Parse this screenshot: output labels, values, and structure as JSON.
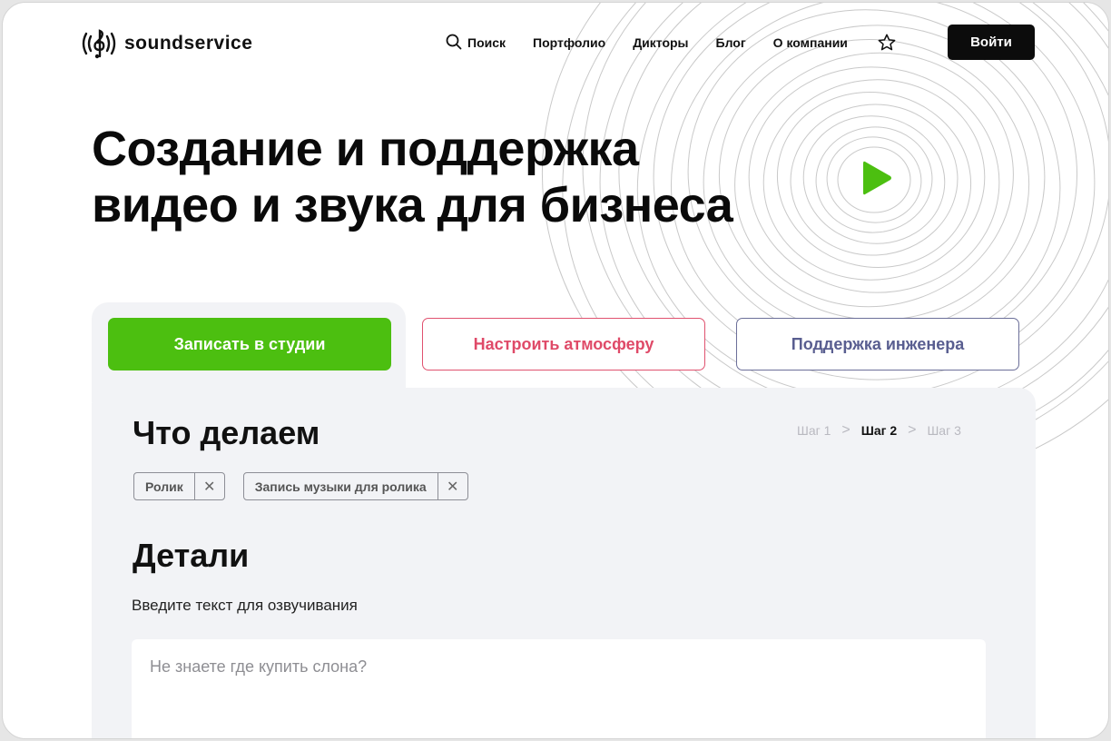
{
  "brand": {
    "logo_text": "soundservice"
  },
  "nav": {
    "search": "Поиск",
    "portfolio": "Портфолио",
    "speakers": "Дикторы",
    "blog": "Блог",
    "about": "О компании",
    "login": "Войти"
  },
  "hero": {
    "title_line1": "Создание и поддержка",
    "title_line2": "видео и звука для бизнеса"
  },
  "tabs": [
    {
      "label": "Записать в студии"
    },
    {
      "label": "Настроить атмосферу"
    },
    {
      "label": "Поддержка инженера"
    }
  ],
  "form": {
    "section1_title": "Что делаем",
    "steps": [
      "Шаг 1",
      "Шаг 2",
      "Шаг 3"
    ],
    "chips": [
      {
        "label": "Ролик"
      },
      {
        "label": "Запись музыки для ролика"
      }
    ],
    "section2_title": "Детали",
    "text_label": "Введите текст для озвучивания",
    "text_placeholder": "Не знаете где купить слона?"
  },
  "colors": {
    "primary_green": "#4cbf10",
    "accent_pink": "#e0526f",
    "accent_indigo": "#6c6f99",
    "dark": "#0c0c0c",
    "panel_bg": "#f2f3f6"
  },
  "icons": {
    "search": "search-icon",
    "star": "star-icon",
    "play": "play-icon",
    "close": "close-icon",
    "logo": "treble-clef-icon"
  }
}
